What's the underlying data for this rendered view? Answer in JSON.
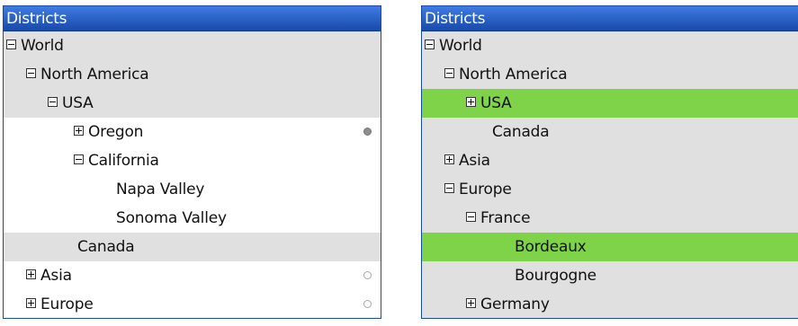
{
  "left_panel": {
    "title": "Districts",
    "rows": [
      {
        "label": "World",
        "toggle": "minus"
      },
      {
        "label": "North America",
        "toggle": "minus"
      },
      {
        "label": "USA",
        "toggle": "minus"
      },
      {
        "label": "Oregon",
        "toggle": "plus",
        "indicator": "filled-dot"
      },
      {
        "label": "California",
        "toggle": "minus"
      },
      {
        "label": "Napa Valley",
        "toggle": "none"
      },
      {
        "label": "Sonoma Valley",
        "toggle": "none"
      },
      {
        "label": "Canada",
        "toggle": "none"
      },
      {
        "label": "Asia",
        "toggle": "plus",
        "indicator": "hollow-dot"
      },
      {
        "label": "Europe",
        "toggle": "plus",
        "indicator": "hollow-dot"
      }
    ]
  },
  "right_panel": {
    "title": "Districts",
    "rows": [
      {
        "label": "World",
        "toggle": "minus"
      },
      {
        "label": "North America",
        "toggle": "minus"
      },
      {
        "label": "USA",
        "toggle": "plus",
        "state": "highlighted"
      },
      {
        "label": "Canada",
        "toggle": "none"
      },
      {
        "label": "Asia",
        "toggle": "plus"
      },
      {
        "label": "Europe",
        "toggle": "minus"
      },
      {
        "label": "France",
        "toggle": "minus"
      },
      {
        "label": "Bordeaux",
        "toggle": "none",
        "state": "highlighted"
      },
      {
        "label": "Bourgogne",
        "toggle": "none"
      },
      {
        "label": "Germany",
        "toggle": "plus"
      }
    ]
  },
  "colors": {
    "header_blue": "#1849a8",
    "row_grey": "#e0e0e0",
    "highlight_green": "#7ed349"
  }
}
